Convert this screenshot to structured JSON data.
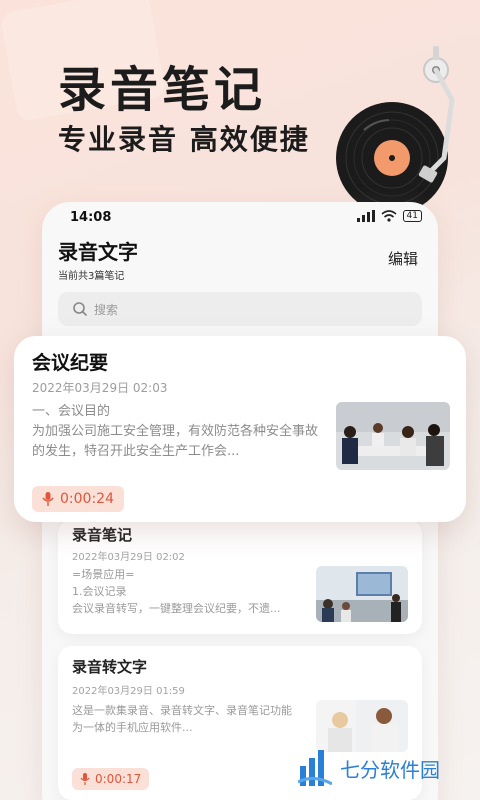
{
  "hero": {
    "title": "录音笔记",
    "subtitle": "专业录音 高效便捷"
  },
  "status_bar": {
    "time": "14:08",
    "battery": "41",
    "network": "HD"
  },
  "app": {
    "title": "录音文字",
    "subtitle": "当前共3篇笔记",
    "edit_label": "编辑",
    "search_placeholder": "搜索"
  },
  "notes": [
    {
      "title": "会议纪要",
      "date": "2022年03月29日 02:03",
      "text": "一、会议目的\n为加强公司施工安全管理，有效防范各种安全事故的发生，特召开此安全生产工作会...",
      "duration": "0:00:24"
    },
    {
      "title": "录音笔记",
      "date": "2022年03月29日 02:02",
      "text": "=场景应用=\n1.会议记录\n会议录音转写，一键整理会议纪要，不遗...",
      "duration": ""
    },
    {
      "title": "录音转文字",
      "date": "2022年03月29日 01:59",
      "text": "这是一款集录音、录音转文字、录音笔记功能为一体的手机应用软件...",
      "duration": "0:00:17"
    }
  ],
  "watermark": {
    "text": "七分软件园"
  },
  "colors": {
    "accent": "#e0563a",
    "accent_bg": "#fbe0d8",
    "watermark": "#2a7fd6"
  }
}
